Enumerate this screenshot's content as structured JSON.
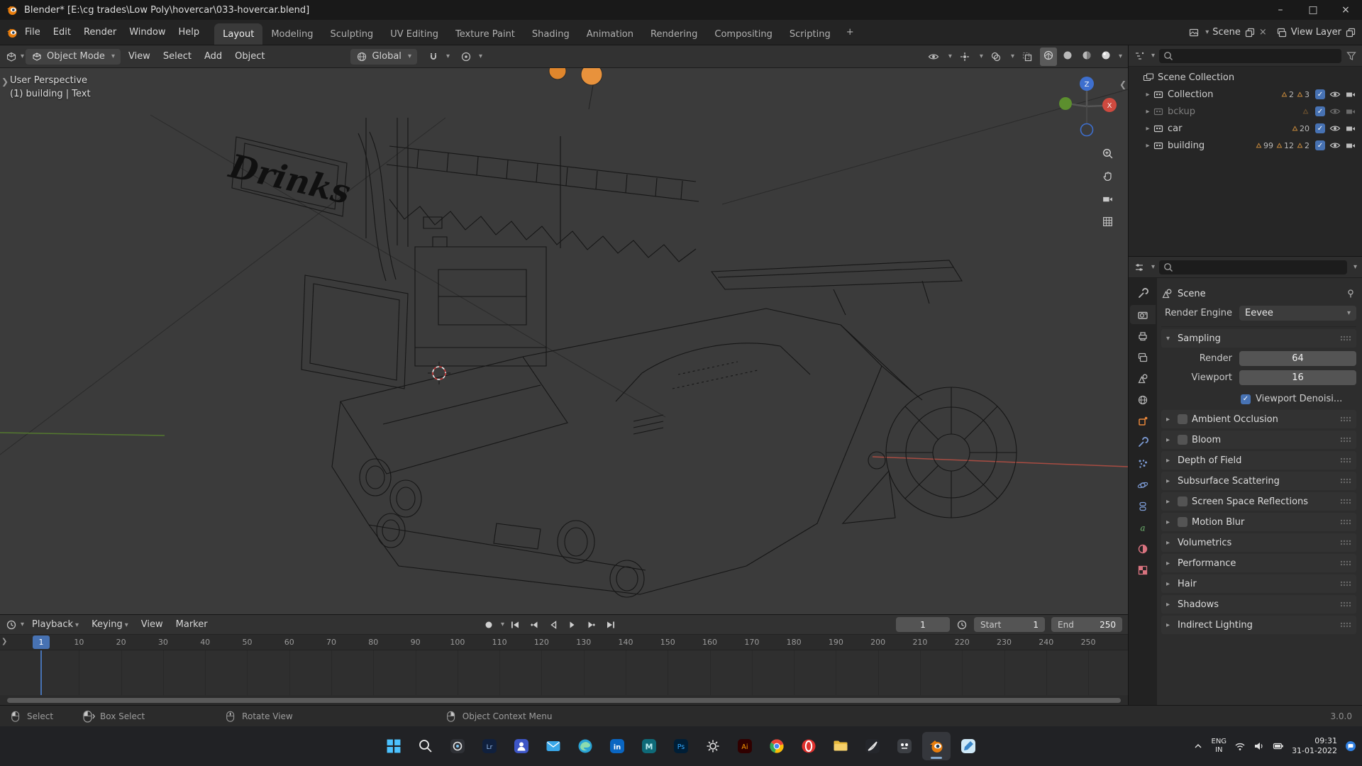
{
  "title_bar": {
    "title": "Blender* [E:\\cg trades\\Low Poly\\hovercar\\033-hovercar.blend]",
    "minimize": "–",
    "maximize": "□",
    "close": "×"
  },
  "menu_bar": {
    "menus": [
      "File",
      "Edit",
      "Render",
      "Window",
      "Help"
    ],
    "workspaces": [
      "Layout",
      "Modeling",
      "Sculpting",
      "UV Editing",
      "Texture Paint",
      "Shading",
      "Animation",
      "Rendering",
      "Compositing",
      "Scripting"
    ],
    "active_workspace": "Layout",
    "add_tab": "+",
    "scene_label": "Scene",
    "view_layer_label": "View Layer"
  },
  "tool_header": {
    "mode_label": "Object Mode",
    "menus": [
      "View",
      "Select",
      "Add",
      "Object"
    ],
    "orientation_label": "Global"
  },
  "viewport": {
    "perspective_label": "User Perspective",
    "selection_label": "(1) building | Text",
    "sign_text": "Drinks",
    "gizmo": {
      "z": "Z",
      "x": "X"
    }
  },
  "outliner": {
    "rows": [
      {
        "name": "Scene Collection",
        "type": "scene-collection",
        "depth": 0,
        "badges": [],
        "controls": false,
        "muted": false
      },
      {
        "name": "Collection",
        "type": "collection",
        "depth": 1,
        "badges": [
          "2",
          "3"
        ],
        "controls": true,
        "muted": false
      },
      {
        "name": "bckup",
        "type": "collection",
        "depth": 1,
        "badges": [
          ""
        ],
        "controls": true,
        "muted": true
      },
      {
        "name": "car",
        "type": "collection",
        "depth": 1,
        "badges": [
          "20"
        ],
        "controls": true,
        "muted": false
      },
      {
        "name": "building",
        "type": "collection",
        "depth": 1,
        "badges": [
          "99",
          "12",
          "2"
        ],
        "controls": true,
        "muted": false
      }
    ]
  },
  "properties": {
    "nav_tabs": [
      {
        "id": "tool",
        "active": false
      },
      {
        "id": "render",
        "active": true
      },
      {
        "id": "output",
        "active": false
      },
      {
        "id": "view-layer",
        "active": false
      },
      {
        "id": "scene",
        "active": false
      },
      {
        "id": "world",
        "active": false
      },
      {
        "id": "object",
        "active": false
      },
      {
        "id": "modifiers",
        "active": false
      },
      {
        "id": "particles",
        "active": false
      },
      {
        "id": "physics",
        "active": false
      },
      {
        "id": "constraints",
        "active": false
      },
      {
        "id": "object-data",
        "active": false
      },
      {
        "id": "material",
        "active": false
      },
      {
        "id": "texture",
        "active": false
      }
    ],
    "breadcrumb": "Scene",
    "render_engine_label": "Render Engine",
    "render_engine_value": "Eevee",
    "sampling": {
      "title": "Sampling",
      "rows": [
        {
          "label": "Render",
          "value": "64"
        },
        {
          "label": "Viewport",
          "value": "16"
        }
      ],
      "checkbox_label": "Viewport Denoisi...",
      "checkbox_checked": true
    },
    "sections": [
      {
        "label": "Ambient Occlusion",
        "has_checkbox": true
      },
      {
        "label": "Bloom",
        "has_checkbox": true
      },
      {
        "label": "Depth of Field",
        "has_checkbox": false
      },
      {
        "label": "Subsurface Scattering",
        "has_checkbox": false
      },
      {
        "label": "Screen Space Reflections",
        "has_checkbox": true
      },
      {
        "label": "Motion Blur",
        "has_checkbox": true
      },
      {
        "label": "Volumetrics",
        "has_checkbox": false
      },
      {
        "label": "Performance",
        "has_checkbox": false
      },
      {
        "label": "Hair",
        "has_checkbox": false
      },
      {
        "label": "Shadows",
        "has_checkbox": false
      },
      {
        "label": "Indirect Lighting",
        "has_checkbox": false
      }
    ]
  },
  "timeline": {
    "menus": [
      "Playback",
      "Keying",
      "View",
      "Marker"
    ],
    "current_frame": "1",
    "playhead_label": "1",
    "start_label": "Start",
    "start_value": "1",
    "end_label": "End",
    "end_value": "250",
    "ticks": [
      "10",
      "20",
      "30",
      "40",
      "50",
      "60",
      "70",
      "80",
      "90",
      "100",
      "110",
      "120",
      "130",
      "140",
      "150",
      "160",
      "170",
      "180",
      "190",
      "200",
      "210",
      "220",
      "230",
      "240",
      "250"
    ]
  },
  "status_bar": {
    "hints": [
      {
        "icon": "mouse-left",
        "label": "Select"
      },
      {
        "icon": "mouse-left-drag",
        "label": "Box Select"
      },
      {
        "icon": "mouse-middle",
        "label": "Rotate View"
      },
      {
        "icon": "mouse-right",
        "label": "Object Context Menu"
      }
    ],
    "version": "3.0.0"
  },
  "taskbar": {
    "apps": [
      {
        "id": "start",
        "active": false
      },
      {
        "id": "search",
        "active": false
      },
      {
        "id": "photos",
        "active": false
      },
      {
        "id": "lightroom",
        "active": false
      },
      {
        "id": "teams",
        "active": false
      },
      {
        "id": "mail",
        "active": false
      },
      {
        "id": "edge",
        "active": false
      },
      {
        "id": "linkedin",
        "active": false
      },
      {
        "id": "maya",
        "active": false
      },
      {
        "id": "photoshop",
        "active": false
      },
      {
        "id": "settings",
        "active": false
      },
      {
        "id": "illustrator",
        "active": false
      },
      {
        "id": "chrome",
        "active": false
      },
      {
        "id": "opera",
        "active": false
      },
      {
        "id": "file-explorer",
        "active": false
      },
      {
        "id": "krita",
        "active": false
      },
      {
        "id": "gimp",
        "active": false
      },
      {
        "id": "blender",
        "active": true
      },
      {
        "id": "paint",
        "active": false
      }
    ],
    "tray": {
      "language_line1": "ENG",
      "language_line2": "IN",
      "time": "09:31",
      "date": "31-01-2022"
    }
  }
}
